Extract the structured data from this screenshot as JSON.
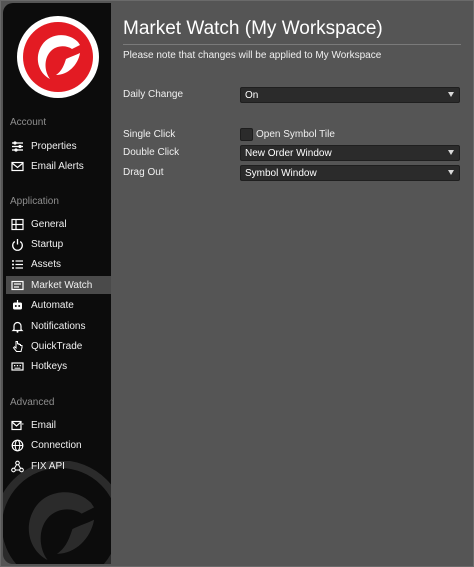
{
  "sidebar": {
    "sections": [
      {
        "label": "Account"
      },
      {
        "label": "Application"
      },
      {
        "label": "Advanced"
      }
    ],
    "items": [
      {
        "label": "Properties",
        "icon": "properties-icon"
      },
      {
        "label": "Email Alerts",
        "icon": "email-alerts-icon"
      },
      {
        "label": "General",
        "icon": "general-icon"
      },
      {
        "label": "Startup",
        "icon": "startup-icon"
      },
      {
        "label": "Assets",
        "icon": "assets-icon"
      },
      {
        "label": "Market Watch",
        "icon": "market-watch-icon",
        "active": true
      },
      {
        "label": "Automate",
        "icon": "automate-icon"
      },
      {
        "label": "Notifications",
        "icon": "bell-icon"
      },
      {
        "label": "QuickTrade",
        "icon": "pointer-hand-icon"
      },
      {
        "label": "Hotkeys",
        "icon": "keyboard-icon"
      },
      {
        "label": "Email",
        "icon": "email-icon"
      },
      {
        "label": "Connection",
        "icon": "globe-icon"
      },
      {
        "label": "FIX API",
        "icon": "network-icon"
      }
    ]
  },
  "main": {
    "title": "Market Watch (My Workspace)",
    "note": "Please note that changes will be applied to My Workspace",
    "daily_change": {
      "label": "Daily Change",
      "value": "On"
    },
    "single_click": {
      "label": "Single Click",
      "checkbox_label": "Open Symbol Tile",
      "checked": false
    },
    "double_click": {
      "label": "Double Click",
      "value": "New Order Window"
    },
    "drag_out": {
      "label": "Drag Out",
      "value": "Symbol Window"
    }
  },
  "colors": {
    "background": "#555555",
    "sidebar": "#0c0c0c",
    "brand_red": "#e31b23",
    "active_item": "#4a4a4a",
    "control": "#2b2b2b"
  }
}
